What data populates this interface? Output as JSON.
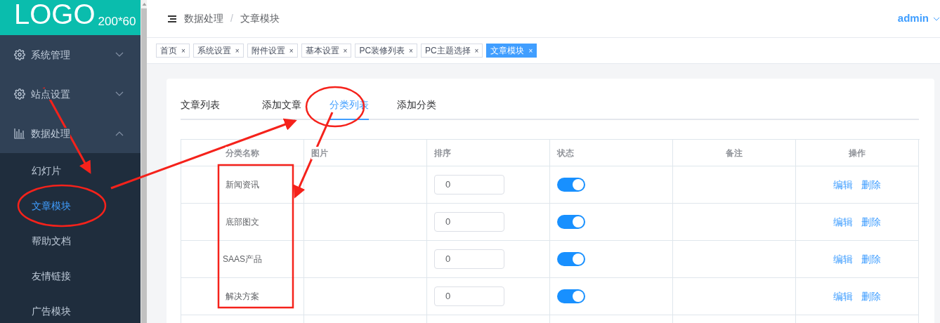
{
  "logo": {
    "text": "LOGO",
    "size": "200*60"
  },
  "sidebar": {
    "items": [
      {
        "label": "系统管理",
        "expanded": false
      },
      {
        "label": "站点设置",
        "expanded": false
      },
      {
        "label": "数据处理",
        "expanded": true,
        "children": [
          {
            "label": "幻灯片",
            "selected": false
          },
          {
            "label": "文章模块",
            "selected": true
          },
          {
            "label": "帮助文档",
            "selected": false
          },
          {
            "label": "友情链接",
            "selected": false
          },
          {
            "label": "广告模块",
            "selected": false
          }
        ]
      }
    ]
  },
  "breadcrumb": [
    "数据处理",
    "文章模块"
  ],
  "breadcrumb_separator": "/",
  "user": "admin",
  "tags": [
    {
      "label": "首页",
      "selected": false
    },
    {
      "label": "系统设置",
      "selected": false
    },
    {
      "label": "附件设置",
      "selected": false
    },
    {
      "label": "基本设置",
      "selected": false
    },
    {
      "label": "PC装修列表",
      "selected": false
    },
    {
      "label": "PC主题选择",
      "selected": false
    },
    {
      "label": "文章模块",
      "selected": true
    }
  ],
  "tag_close": "×",
  "tabs": [
    {
      "label": "文章列表",
      "selected": false
    },
    {
      "label": "添加文章",
      "selected": false
    },
    {
      "label": "分类列表",
      "selected": true
    },
    {
      "label": "添加分类",
      "selected": false
    }
  ],
  "table": {
    "columns": [
      "分类名称",
      "图片",
      "排序",
      "状态",
      "备注",
      "操作"
    ],
    "rows": [
      {
        "name": "新闻资讯",
        "sort": "0",
        "on": true,
        "actions": [
          "编辑",
          "删除"
        ]
      },
      {
        "name": "底部图文",
        "sort": "0",
        "on": true,
        "actions": [
          "编辑",
          "删除"
        ]
      },
      {
        "name": "SAAS产品",
        "sort": "0",
        "on": true,
        "actions": [
          "编辑",
          "删除"
        ]
      },
      {
        "name": "解决方案",
        "sort": "0",
        "on": true,
        "actions": [
          "编辑",
          "删除"
        ]
      }
    ]
  }
}
